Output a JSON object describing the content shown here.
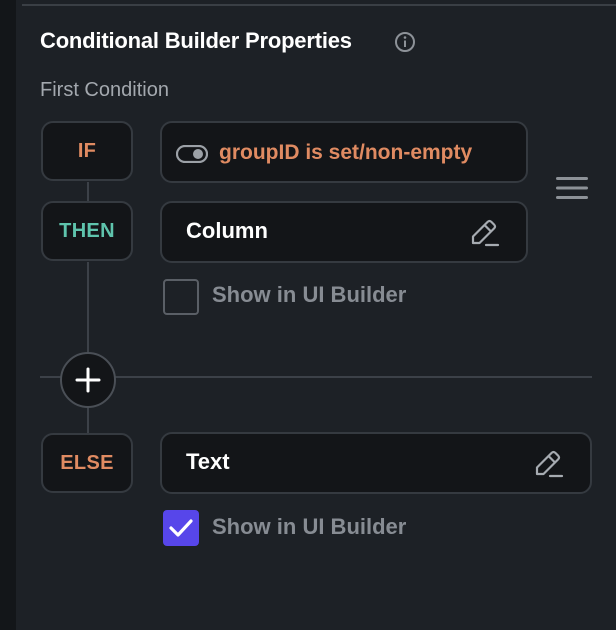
{
  "panel": {
    "title": "Conditional Builder Properties",
    "subtitle": "First Condition"
  },
  "conditions": {
    "if_label": "IF",
    "then_label": "THEN",
    "else_label": "ELSE",
    "if_value": "groupID is set/non-empty",
    "then_widget": "Column",
    "else_widget": "Text"
  },
  "checkboxes": {
    "then_show_label": "Show in UI Builder",
    "then_checked": false,
    "else_show_label": "Show in UI Builder",
    "else_checked": true
  },
  "icons": {
    "info": "info-icon",
    "toggle": "toggle-icon",
    "edit": "pencil-edit-icon",
    "menu": "hamburger-menu-icon",
    "add": "plus-icon",
    "check": "checkmark-icon"
  },
  "colors": {
    "background": "#1d2126",
    "box_background": "#131518",
    "if_color": "#e08b62",
    "then_color": "#5fc4ad",
    "else_color": "#e08b62",
    "condition_text": "#e08b62",
    "checkbox_checked": "#5746ea"
  }
}
